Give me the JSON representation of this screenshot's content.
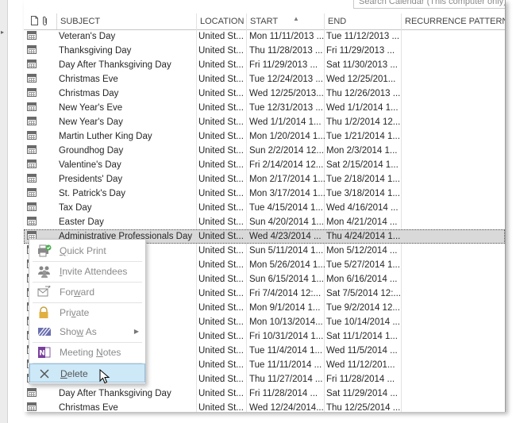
{
  "search": {
    "placeholder": "Search Calendar (This computer only)"
  },
  "header": {
    "subject": "SUBJECT",
    "location": "LOCATION",
    "start": "START",
    "end": "END",
    "recurrence": "RECURRENCE PATTERN"
  },
  "rows": [
    {
      "subject": "Veteran's Day",
      "location": "United St...",
      "start": "Mon 11/11/2013 ...",
      "end": "Tue 11/12/2013 ..."
    },
    {
      "subject": "Thanksgiving Day",
      "location": "United St...",
      "start": "Thu 11/28/2013 ...",
      "end": "Fri 11/29/2013 ..."
    },
    {
      "subject": "Day After Thanksgiving Day",
      "location": "United St...",
      "start": "Fri 11/29/2013 ...",
      "end": "Sat 11/30/2013 ..."
    },
    {
      "subject": "Christmas Eve",
      "location": "United St...",
      "start": "Tue 12/24/2013 ...",
      "end": "Wed 12/25/201..."
    },
    {
      "subject": "Christmas Day",
      "location": "United St...",
      "start": "Wed 12/25/2013...",
      "end": "Thu 12/26/2013 ..."
    },
    {
      "subject": "New Year's Eve",
      "location": "United St...",
      "start": "Tue 12/31/2013 ...",
      "end": "Wed 1/1/2014 1..."
    },
    {
      "subject": "New Year's Day",
      "location": "United St...",
      "start": "Wed 1/1/2014 1...",
      "end": "Thu 1/2/2014 12..."
    },
    {
      "subject": "Martin Luther King Day",
      "location": "United St...",
      "start": "Mon 1/20/2014 1...",
      "end": "Tue 1/21/2014 1..."
    },
    {
      "subject": "Groundhog Day",
      "location": "United St...",
      "start": "Sun 2/2/2014 12...",
      "end": "Mon 2/3/2014 1..."
    },
    {
      "subject": "Valentine's Day",
      "location": "United St...",
      "start": "Fri 2/14/2014 12...",
      "end": "Sat 2/15/2014 1..."
    },
    {
      "subject": "Presidents' Day",
      "location": "United St...",
      "start": "Mon 2/17/2014 1...",
      "end": "Tue 2/18/2014 1..."
    },
    {
      "subject": "St. Patrick's Day",
      "location": "United St...",
      "start": "Mon 3/17/2014 1...",
      "end": "Tue 3/18/2014 1..."
    },
    {
      "subject": "Tax Day",
      "location": "United St...",
      "start": "Tue 4/15/2014 1...",
      "end": "Wed 4/16/2014 ..."
    },
    {
      "subject": "Easter Day",
      "location": "United St...",
      "start": "Sun 4/20/2014 1...",
      "end": "Mon 4/21/2014 ..."
    },
    {
      "subject": "Administrative Professionals Day",
      "location": "United St...",
      "start": "Wed 4/23/2014 ...",
      "end": "Thu 4/24/2014 1..."
    },
    {
      "subject": "",
      "location": "United St...",
      "start": "Sun 5/11/2014 1...",
      "end": "Mon 5/12/2014 ..."
    },
    {
      "subject": "",
      "location": "United St...",
      "start": "Mon 5/26/2014 1...",
      "end": "Tue 5/27/2014 1..."
    },
    {
      "subject": "",
      "location": "United St...",
      "start": "Sun 6/15/2014 1...",
      "end": "Mon 6/16/2014 ..."
    },
    {
      "subject": "",
      "location": "United St...",
      "start": "Fri 7/4/2014 12:...",
      "end": "Sat 7/5/2014 12:..."
    },
    {
      "subject": "",
      "location": "United St...",
      "start": "Mon 9/1/2014 1...",
      "end": "Tue 9/2/2014 12..."
    },
    {
      "subject": "",
      "location": "United St...",
      "start": "Mon 10/13/2014...",
      "end": "Tue 10/14/2014 ..."
    },
    {
      "subject": "",
      "location": "United St...",
      "start": "Fri 10/31/2014 1...",
      "end": "Sat 11/1/2014 1..."
    },
    {
      "subject": "",
      "location": "United St...",
      "start": "Tue 11/4/2014 1...",
      "end": "Wed 11/5/2014 ..."
    },
    {
      "subject": "",
      "location": "United St...",
      "start": "Tue 11/11/2014 ...",
      "end": "Wed 11/12/201..."
    },
    {
      "subject": "",
      "location": "United St...",
      "start": "Thu 11/27/2014 ...",
      "end": "Fri 11/28/2014 ..."
    },
    {
      "subject": "Day After Thanksgiving Day",
      "location": "United St...",
      "start": "Fri 11/28/2014 ...",
      "end": "Sat 11/29/2014 ..."
    },
    {
      "subject": "Christmas Eve",
      "location": "United St...",
      "start": "Wed 12/24/2014...",
      "end": "Thu 12/25/2014 ..."
    }
  ],
  "selected_row_index": 14,
  "context_menu": {
    "items": [
      {
        "label": "Quick Print",
        "icon": "quick-print-icon",
        "enabled": false
      },
      {
        "label": "Invite Attendees",
        "icon": "invite-attendees-icon",
        "enabled": false
      },
      {
        "label": "Forward",
        "icon": "forward-icon",
        "enabled": false
      },
      {
        "label": "Private",
        "icon": "lock-icon",
        "enabled": false
      },
      {
        "label": "Show As",
        "icon": "show-as-icon",
        "enabled": false,
        "submenu": true
      },
      {
        "label": "Meeting Notes",
        "icon": "onenote-icon",
        "enabled": false
      },
      {
        "label": "Delete",
        "icon": "delete-x-icon",
        "enabled": true,
        "hovered": true
      }
    ]
  },
  "colors": {
    "selection": "#d9d9d9",
    "hover": "#cde8f7",
    "disabled_text": "#8a8a8a",
    "grid_line": "#e2e2e2"
  }
}
